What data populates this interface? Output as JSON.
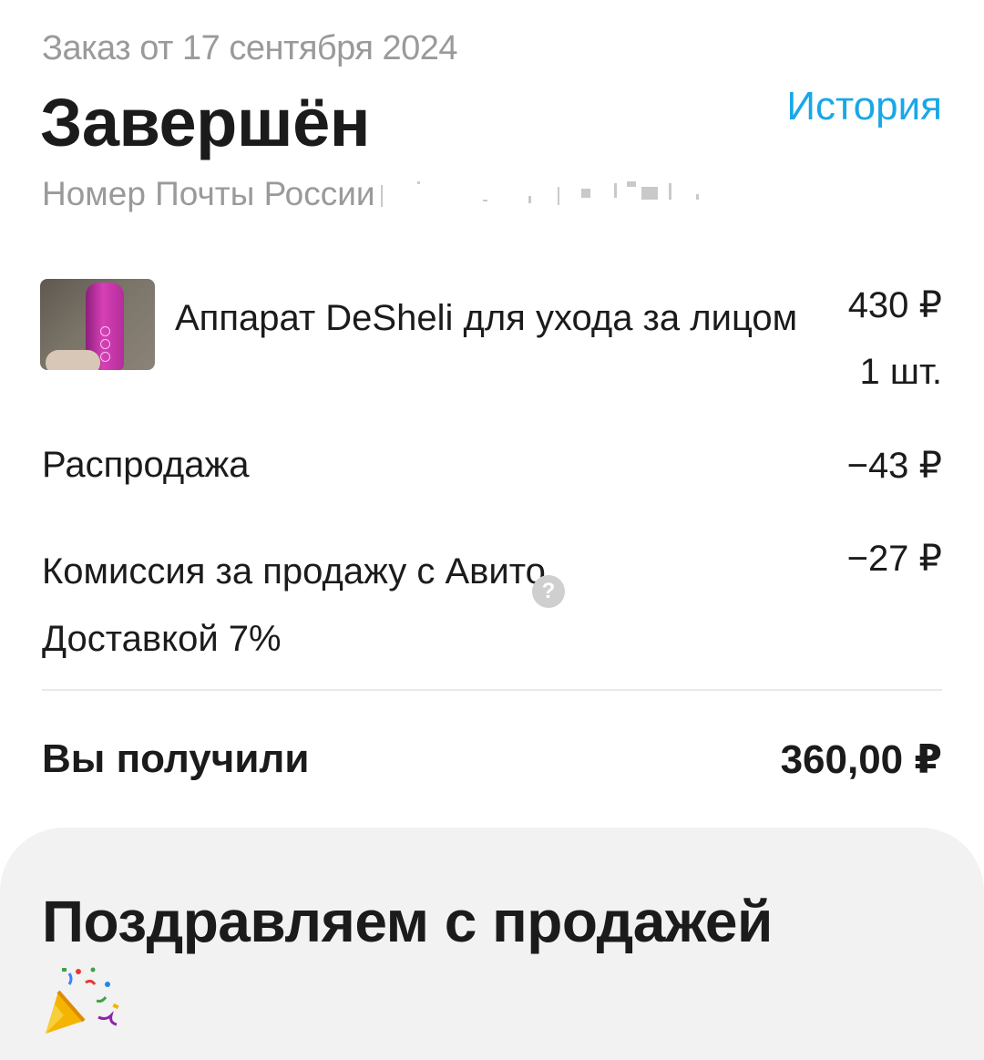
{
  "header": {
    "order_date": "Заказ от 17 сентября 2024",
    "status": "Завершён",
    "history_label": "История",
    "tracking_label": "Номер Почты России",
    "history_color": "#1aa7e8"
  },
  "item": {
    "name": "Аппарат DeSheli для ухода за лицом",
    "price": "430 ₽",
    "quantity": "1 шт.",
    "thumbnail_icon": "product-photo"
  },
  "adjustments": {
    "sale_label": "Распродажа",
    "sale_value": "−43 ₽",
    "commission_label": "Комиссия за продажу с Авито Доставкой 7%",
    "commission_value": "−27 ₽",
    "help_icon": "?"
  },
  "total": {
    "label": "Вы получили",
    "value": "360,00 ₽"
  },
  "congrats": {
    "title": "Поздравляем с продажей",
    "icon": "party-popper-icon"
  }
}
